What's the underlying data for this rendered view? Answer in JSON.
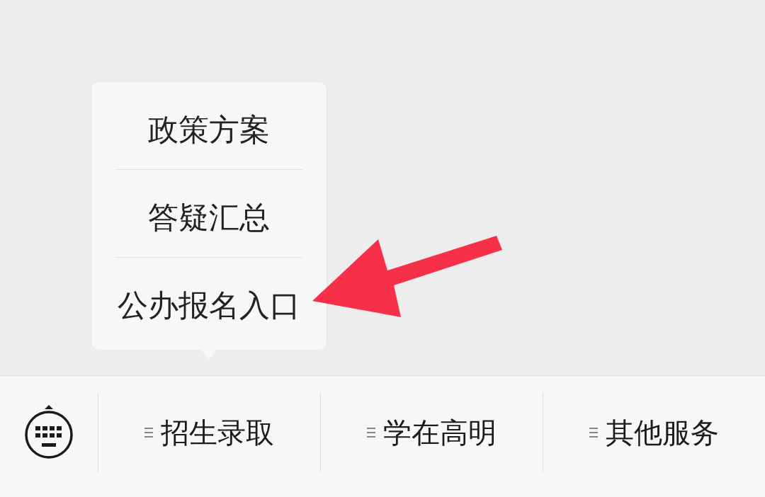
{
  "bottom_menu": {
    "items": [
      {
        "label": "招生录取",
        "submenu": [
          {
            "label": "政策方案",
            "annotated": false
          },
          {
            "label": "答疑汇总",
            "annotated": false
          },
          {
            "label": "公办报名入口",
            "annotated": true
          }
        ]
      },
      {
        "label": "学在高明"
      },
      {
        "label": "其他服务"
      }
    ]
  }
}
